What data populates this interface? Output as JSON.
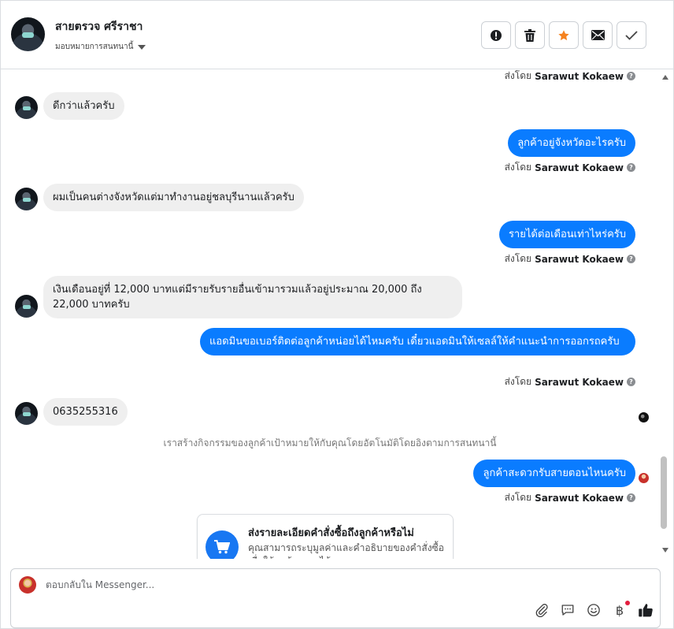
{
  "header": {
    "contact_name": "สายตรวจ ศรีราชา",
    "assign_label": "มอบหมายการสนทนานี้",
    "actions": [
      {
        "name": "spam-button",
        "icon": "exclamation-icon"
      },
      {
        "name": "delete-button",
        "icon": "trash-icon"
      },
      {
        "name": "star-button",
        "icon": "star-icon",
        "color": "#f5821f"
      },
      {
        "name": "mark-unread-button",
        "icon": "envelope-icon"
      },
      {
        "name": "done-button",
        "icon": "check-icon"
      }
    ]
  },
  "sent_by": {
    "prefix": "ส่งโดย",
    "agent": "Sarawut Kokaew"
  },
  "messages": [
    {
      "dir": "in",
      "text": "ดีกว่าแล้วครับ"
    },
    {
      "dir": "out",
      "text": "ลูกค้าอยู่จังหวัดอะไรครับ"
    },
    {
      "dir": "in",
      "text": "ผมเป็นคนต่างจังหวัดแต่มาทำงานอยู่ชลบุรีนานแล้วครับ"
    },
    {
      "dir": "out",
      "text": "รายได้ต่อเดือนเท่าไหร่ครับ"
    },
    {
      "dir": "in",
      "text": "เงินเดือนอยู่ที่ 12,000 บาทแต่มีรายรับรายอื่นเข้ามารวมแล้วอยู่ประมาณ 20,000 ถึง 22,000 บาทครับ"
    },
    {
      "dir": "out",
      "text": "แอดมินขอเบอร์ติดต่อลูกค้าหน่อยได้ไหมครับ เดี๋ยวแอดมินให้เซลล์ให้คำแนะนำการออกรถครับ"
    },
    {
      "dir": "in",
      "text": "0635255316"
    },
    {
      "dir": "out",
      "text": "ลูกค้าสะดวกรับสายตอนไหนครับ"
    }
  ],
  "system_note": "เราสร้างกิจกรรมของลูกค้าเป้าหมายให้กับคุณโดยอัตโนมัติโดยอิงตามการสนทนานี้",
  "order_card": {
    "title": "ส่งรายละเอียดคำสั่งซื้อถึงลูกค้าหรือไม่",
    "description": "คุณสามารถระบุมูลค่าและคำอธิบายของคำสั่งซื้อ เพื่อให้ลูกค้าทราบได้",
    "icon": "cart-icon"
  },
  "composer": {
    "placeholder": "ตอบกลับใน Messenger...",
    "tools": [
      "paperclip-icon",
      "saved-reply-icon",
      "emoji-icon",
      "baht-icon",
      "like-icon"
    ],
    "baht_symbol": "฿"
  },
  "colors": {
    "outgoing_bubble": "#0a7cff",
    "incoming_bubble": "#efefef",
    "accent": "#1877f2"
  }
}
